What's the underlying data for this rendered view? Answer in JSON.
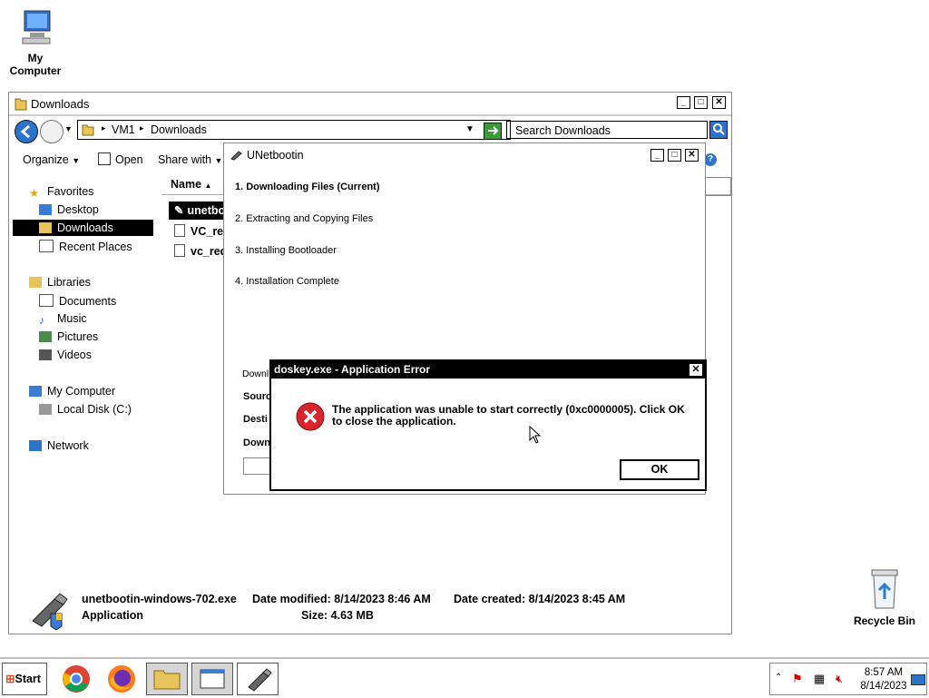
{
  "desktop": {
    "my_computer": "My Computer",
    "recycle_bin": "Recycle Bin"
  },
  "explorer": {
    "title": "Downloads",
    "address": [
      "VM1",
      "Downloads"
    ],
    "search_placeholder": "Search Downloads",
    "toolbar": {
      "organize": "Organize",
      "open": "Open",
      "share": "Share with"
    },
    "column_name": "Name",
    "nav": {
      "favorites": "Favorites",
      "desktop": "Desktop",
      "downloads": "Downloads",
      "recent": "Recent Places",
      "libraries": "Libraries",
      "documents": "Documents",
      "music": "Music",
      "pictures": "Pictures",
      "videos": "Videos",
      "computer": "My Computer",
      "local_disk": "Local Disk (C:)",
      "network": "Network"
    },
    "files": [
      "unetbo",
      "VC_red",
      "vc_red"
    ],
    "details": {
      "filename": "unetbootin-windows-702.exe",
      "type": "Application",
      "modified": "Date modified: 8/14/2023 8:46 AM",
      "created": "Date created: 8/14/2023 8:45 AM",
      "size": "Size: 4.63 MB"
    }
  },
  "unetbootin": {
    "title": "UNetbootin",
    "steps": [
      "1. Downloading Files (Current)",
      "2. Extracting and Copying Files",
      "3. Installing Bootloader",
      "4. Installation Complete"
    ],
    "labels": [
      "Downl",
      "Sourc",
      "Desti",
      "Down"
    ]
  },
  "error_dialog": {
    "title": "doskey.exe - Application Error",
    "message": "The application was unable to start correctly (0xc0000005). Click OK to close the application.",
    "ok": "OK"
  },
  "taskbar": {
    "start": "Start",
    "time": "8:57 AM",
    "date": "8/14/2023"
  },
  "colors": {
    "error_red": "#d9242b",
    "selection": "#000000"
  }
}
